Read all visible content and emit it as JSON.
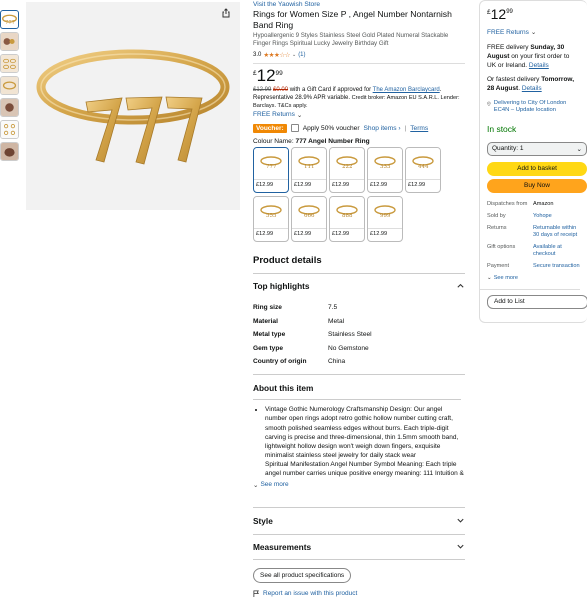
{
  "product": {
    "store_link": "Visit the Yaowish Store",
    "title": "Rings for Women Size P , Angel Number Nontarnish Band Ring",
    "subtitle": "Hypoallergenic 9 Styles Stainless Steel Gold Plated Numeral Stackable Finger Rings Spiritual Lucky Jewelry Birthday Gift",
    "rating_value": "3.0",
    "rating_stars": "★★★☆☆",
    "rating_count": "(1)",
    "price_currency": "£",
    "price_whole": "12",
    "price_fraction": "99",
    "gift_prefix_strike": "£12.99",
    "gift_prefix_red": "£0.00",
    "gift_text": " with a Gift Card if approved for ",
    "gift_link": "The Amazon Barclaycard",
    "gift_rep": ".",
    "apr_text": "Representative 28.9% APR variable.",
    "credit_text": " Credit broker: Amazon EU S.A.R.L. Lender: Barclays. T&Cs apply.",
    "free_returns": "FREE Returns",
    "voucher_label": "Voucher:",
    "voucher_text": "Apply 50% voucher",
    "shop_items": "Shop items ›",
    "terms": "Terms",
    "colour_label": "Colour Name:",
    "colour_value": "777 Angel Number Ring",
    "swatches": [
      {
        "price": "£12.99",
        "label": "777"
      },
      {
        "price": "£12.99",
        "label": "111"
      },
      {
        "price": "£12.99",
        "label": "222"
      },
      {
        "price": "£12.99",
        "label": "333"
      },
      {
        "price": "£12.99",
        "label": "444"
      },
      {
        "price": "£12.99",
        "label": "555"
      },
      {
        "price": "£12.99",
        "label": "666"
      },
      {
        "price": "£12.99",
        "label": "888"
      },
      {
        "price": "£12.99",
        "label": "999"
      }
    ]
  },
  "details": {
    "section_title": "Product details",
    "highlights_title": "Top highlights",
    "specs": [
      {
        "k": "Ring size",
        "v": "7.5"
      },
      {
        "k": "Material",
        "v": "Metal"
      },
      {
        "k": "Metal type",
        "v": "Stainless Steel"
      },
      {
        "k": "Gem type",
        "v": "No Gemstone"
      },
      {
        "k": "Country of origin",
        "v": "China"
      }
    ],
    "about_title": "About this item",
    "about_items": [
      "Vintage Gothic Numerology Craftsmanship Design: Our angel number open rings adopt retro gothic hollow number cutting craft, smooth polished seamless edges without burrs. Each triple-digit carving is precise and three-dimensional, thin 1.5mm smooth band, lightweight hollow design won't weigh down fingers, exquisite minimalist stainless steel jewelry for daily stack wear",
      "Spiritual Manifestation Angel Number Symbol Meaning: Each triple angel number carries unique positive energy meaning: 111 Intuition &"
    ],
    "see_more": "See more",
    "style": "Style",
    "measurements": "Measurements",
    "see_all": "See all product specifications",
    "report": "Report an issue with this product"
  },
  "buybox": {
    "price_currency": "£",
    "price_whole": "12",
    "price_fraction": "99",
    "free_returns": "FREE Returns",
    "delivery_prefix": "FREE delivery ",
    "delivery_date": "Sunday, 30 August",
    "delivery_suffix": " on your first order to UK or Ireland.",
    "details": "Details",
    "fastest_prefix": "Or fastest delivery ",
    "fastest_date": "Tomorrow, 28 August",
    "fastest_suffix": ". ",
    "location": "Delivering to City Of London EC4N – Update location",
    "in_stock": "In stock",
    "quantity": "Quantity: 1",
    "add_to_basket": "Add to basket",
    "buy_now": "Buy Now",
    "info": [
      {
        "k": "Dispatches from",
        "v": "Amazon",
        "plain": true
      },
      {
        "k": "Sold by",
        "v": "Yohope",
        "plain": false
      },
      {
        "k": "Returns",
        "v": "Returnable within 30 days of receipt",
        "plain": false
      },
      {
        "k": "Gift options",
        "v": "Available at checkout",
        "plain": false
      },
      {
        "k": "Payment",
        "v": "Secure transaction",
        "plain": false
      }
    ],
    "see_more": "See more",
    "add_to_list": "Add to List"
  },
  "colors": {
    "accent": "#2162a1",
    "gold": "#d4a54a",
    "cart": "#ffd814",
    "buy": "#ffa41c",
    "instock": "#007600",
    "voucher": "#f08804"
  }
}
